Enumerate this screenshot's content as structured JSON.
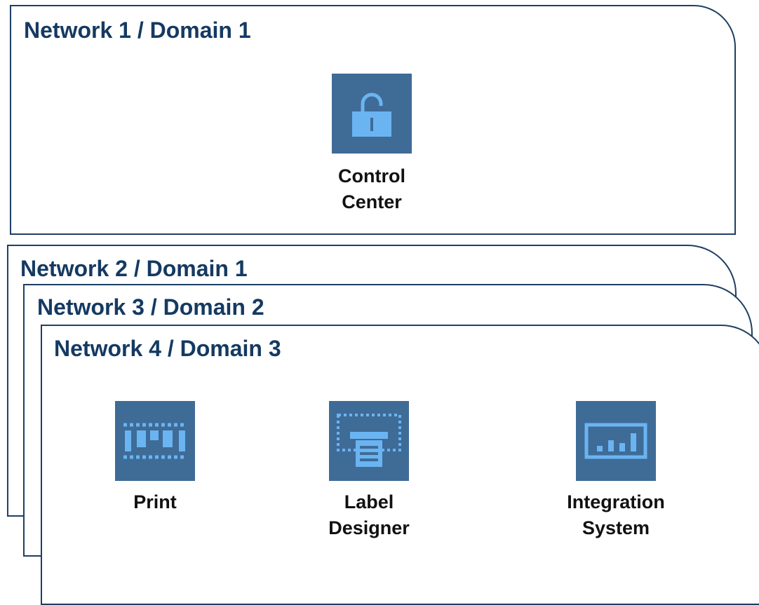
{
  "panels": [
    {
      "title": "Network 1 / Domain 1"
    },
    {
      "title": "Network 2 / Domain 1"
    },
    {
      "title": "Network 3 / Domain 2"
    },
    {
      "title": "Network 4 / Domain 3"
    }
  ],
  "apps": {
    "control_center": {
      "line1": "Control",
      "line2": "Center",
      "icon": "unlocked-padlock-icon"
    },
    "print": {
      "line1": "Print",
      "icon": "printer-module-icon"
    },
    "label_designer": {
      "line1": "Label",
      "line2": "Designer",
      "icon": "label-design-icon"
    },
    "integration_system": {
      "line1": "Integration",
      "line2": "System",
      "icon": "bar-chart-monitor-icon"
    }
  },
  "colors": {
    "panel_border": "#1f3f63",
    "title_text": "#153a62",
    "tile_background": "#3f6b97",
    "icon_color": "#6ab4f2",
    "label_text": "#111111"
  }
}
